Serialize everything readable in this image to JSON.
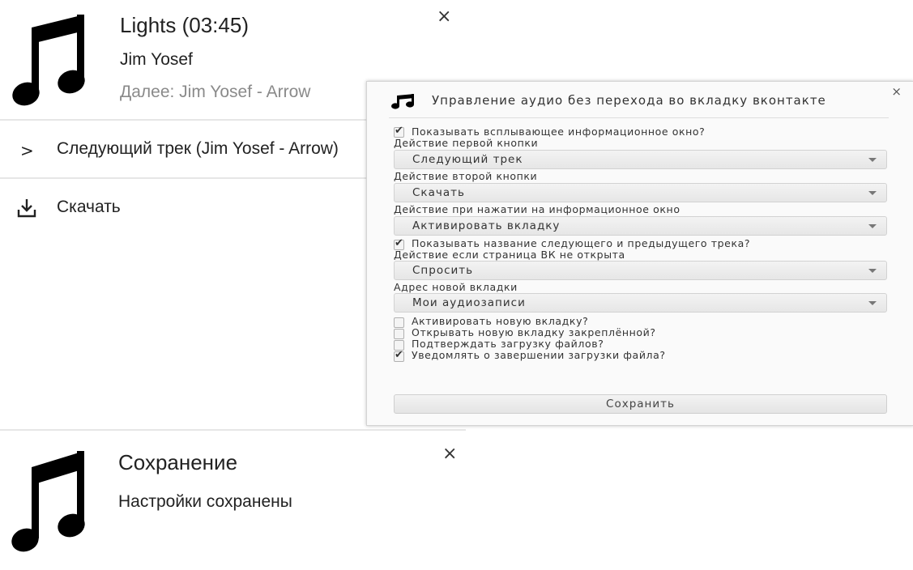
{
  "now_playing": {
    "title": "Lights (03:45)",
    "artist": "Jim Yosef",
    "next": "Далее: Jim Yosef - Arrow",
    "close_glyph": "×",
    "icon": "music-note-icon",
    "actions": [
      {
        "label": "Следующий трек (Jim Yosef - Arrow)",
        "icon": "chevron-right-icon",
        "glyph": ">"
      },
      {
        "label": "Скачать",
        "icon": "download-icon"
      }
    ]
  },
  "settings": {
    "title": "Управление аудио без перехода во вкладку вконтакте",
    "close_glyph": "×",
    "icon": "music-note-icon",
    "show_popup": {
      "label": "Показывать всплывающее информационное окно?",
      "checked": true
    },
    "first_button": {
      "label": "Действие первой кнопки",
      "value": "Следующий трек"
    },
    "second_button": {
      "label": "Действие второй кнопки",
      "value": "Скачать"
    },
    "on_click": {
      "label": "Действие при нажатии на информационное окно",
      "value": "Активировать вкладку"
    },
    "show_track_names": {
      "label": "Показывать название следующего и предыдущего трека?",
      "checked": true
    },
    "vk_not_open": {
      "label": "Действие если страница ВК не открыта",
      "value": "Спросить"
    },
    "new_tab_address": {
      "label": "Адрес новой вкладки",
      "value": "Мои аудиозаписи"
    },
    "checkboxes": [
      {
        "label": "Активировать новую вкладку?",
        "checked": false
      },
      {
        "label": "Открывать новую вкладку закреплённой?",
        "checked": false
      },
      {
        "label": "Подтверждать загрузку файлов?",
        "checked": false
      },
      {
        "label": "Уведомлять о завершении загрузки файла?",
        "checked": true
      }
    ],
    "save_label": "Сохранить"
  },
  "saved_notification": {
    "title": "Сохранение",
    "message": "Настройки сохранены",
    "close_glyph": "×",
    "icon": "music-note-icon"
  },
  "colors": {
    "text": "#222222",
    "muted": "#8a8a8a",
    "panel_bg": "#fafafa",
    "divider": "#e6e6e6"
  }
}
